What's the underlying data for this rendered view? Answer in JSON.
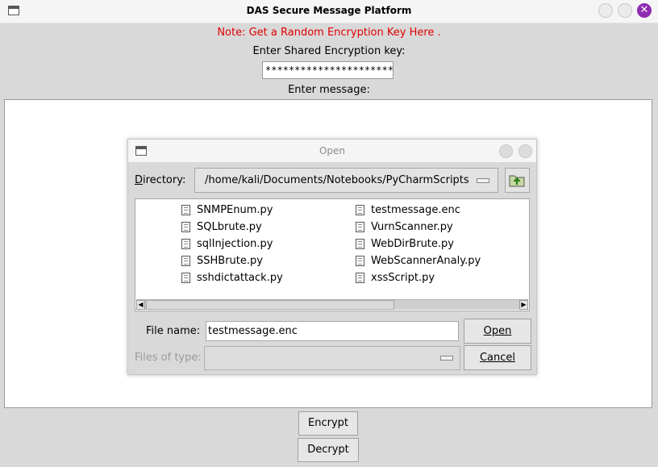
{
  "window": {
    "title": "DAS Secure Message Platform"
  },
  "main": {
    "note": "Note: Get a Random Encryption Key Here .",
    "key_label": "Enter Shared Encryption key:",
    "key_value": "************************",
    "message_label": "Enter message:",
    "encrypt_label": "Encrypt",
    "decrypt_label": "Decrypt"
  },
  "dialog": {
    "title": "Open",
    "directory_label": "Directory:",
    "directory_value": "/home/kali/Documents/Notebooks/PyCharmScripts",
    "files_col1": [
      "SNMPEnum.py",
      "SQLbrute.py",
      "sqlInjection.py",
      "SSHBrute.py",
      "sshdictattack.py"
    ],
    "files_col2": [
      "testmessage.enc",
      "VurnScanner.py",
      "WebDirBrute.py",
      "WebScannerAnaly.py",
      "xssScript.py"
    ],
    "filename_label": "File name:",
    "filename_value": "testmessage.enc",
    "filetype_label": "Files of type:",
    "filetype_value": "",
    "open_label": "Open",
    "cancel_label": "Cancel"
  },
  "colors": {
    "note_red": "#e00000",
    "close_button": "#8e2bb0",
    "background": "#d9d9d9"
  },
  "icons": [
    "window-icon",
    "minimize-icon",
    "maximize-icon",
    "close-icon",
    "folder-up-icon",
    "file-icon",
    "dropdown-icon"
  ]
}
